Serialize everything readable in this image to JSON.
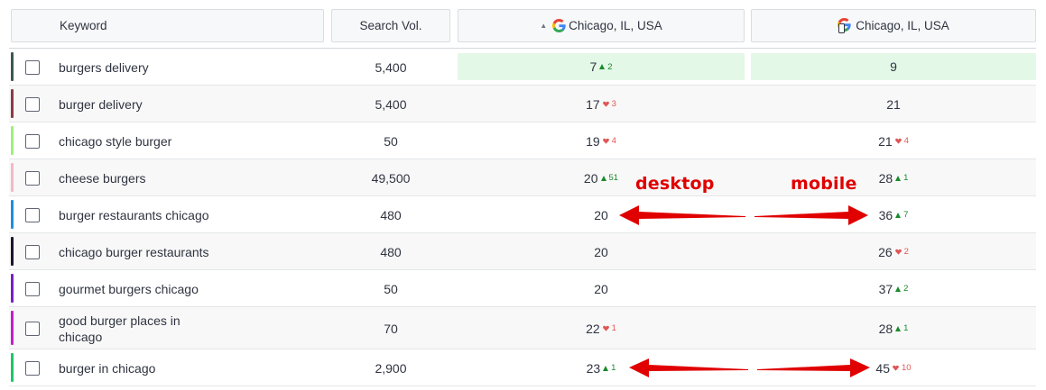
{
  "header": {
    "keyword_label": "Keyword",
    "search_vol_label": "Search Vol.",
    "desktop_location": "Chicago, IL, USA",
    "mobile_location": "Chicago, IL, USA",
    "desktop_sort_icon": "sort-asc-icon",
    "search_engine_icon": "google-icon",
    "mobile_device_icon": "phone-icon"
  },
  "colors": {
    "up": "#1a8a2c",
    "down": "#e05555",
    "highlight": "#e3f8e7",
    "annotation": "#e00000"
  },
  "rows": [
    {
      "keyword": "burgers delivery",
      "search_vol": "5,400",
      "color": "#3c5a4c",
      "desktop": {
        "pos": "7",
        "dir": "up",
        "change": "2",
        "highlight": true
      },
      "mobile": {
        "pos": "9",
        "dir": "",
        "change": "",
        "highlight": true
      }
    },
    {
      "keyword": "burger delivery",
      "search_vol": "5,400",
      "color": "#8b3a44",
      "desktop": {
        "pos": "17",
        "dir": "down",
        "change": "3"
      },
      "mobile": {
        "pos": "21",
        "dir": "",
        "change": ""
      }
    },
    {
      "keyword": "chicago style burger",
      "search_vol": "50",
      "color": "#9cf07b",
      "desktop": {
        "pos": "19",
        "dir": "down",
        "change": "4"
      },
      "mobile": {
        "pos": "21",
        "dir": "down",
        "change": "4"
      }
    },
    {
      "keyword": "cheese burgers",
      "search_vol": "49,500",
      "color": "#f5b8c6",
      "desktop": {
        "pos": "20",
        "dir": "up",
        "change": "51"
      },
      "mobile": {
        "pos": "28",
        "dir": "up",
        "change": "1"
      }
    },
    {
      "keyword": "burger restaurants chicago",
      "search_vol": "480",
      "color": "#1f8fdc",
      "desktop": {
        "pos": "20",
        "dir": "",
        "change": ""
      },
      "mobile": {
        "pos": "36",
        "dir": "up",
        "change": "7"
      }
    },
    {
      "keyword": "chicago burger restaurants",
      "search_vol": "480",
      "color": "#1e1230",
      "desktop": {
        "pos": "20",
        "dir": "",
        "change": ""
      },
      "mobile": {
        "pos": "26",
        "dir": "down",
        "change": "2"
      }
    },
    {
      "keyword": "gourmet burgers chicago",
      "search_vol": "50",
      "color": "#7a1fc4",
      "desktop": {
        "pos": "20",
        "dir": "",
        "change": ""
      },
      "mobile": {
        "pos": "37",
        "dir": "up",
        "change": "2"
      }
    },
    {
      "keyword": "good burger places in chicago",
      "search_vol": "70",
      "color": "#c21fc9",
      "desktop": {
        "pos": "22",
        "dir": "down",
        "change": "1"
      },
      "mobile": {
        "pos": "28",
        "dir": "up",
        "change": "1"
      }
    },
    {
      "keyword": "burger in chicago",
      "search_vol": "2,900",
      "color": "#1fc46a",
      "desktop": {
        "pos": "23",
        "dir": "up",
        "change": "1"
      },
      "mobile": {
        "pos": "45",
        "dir": "down",
        "change": "10"
      }
    }
  ],
  "annotations": {
    "desktop_label": "desktop",
    "mobile_label": "mobile"
  }
}
